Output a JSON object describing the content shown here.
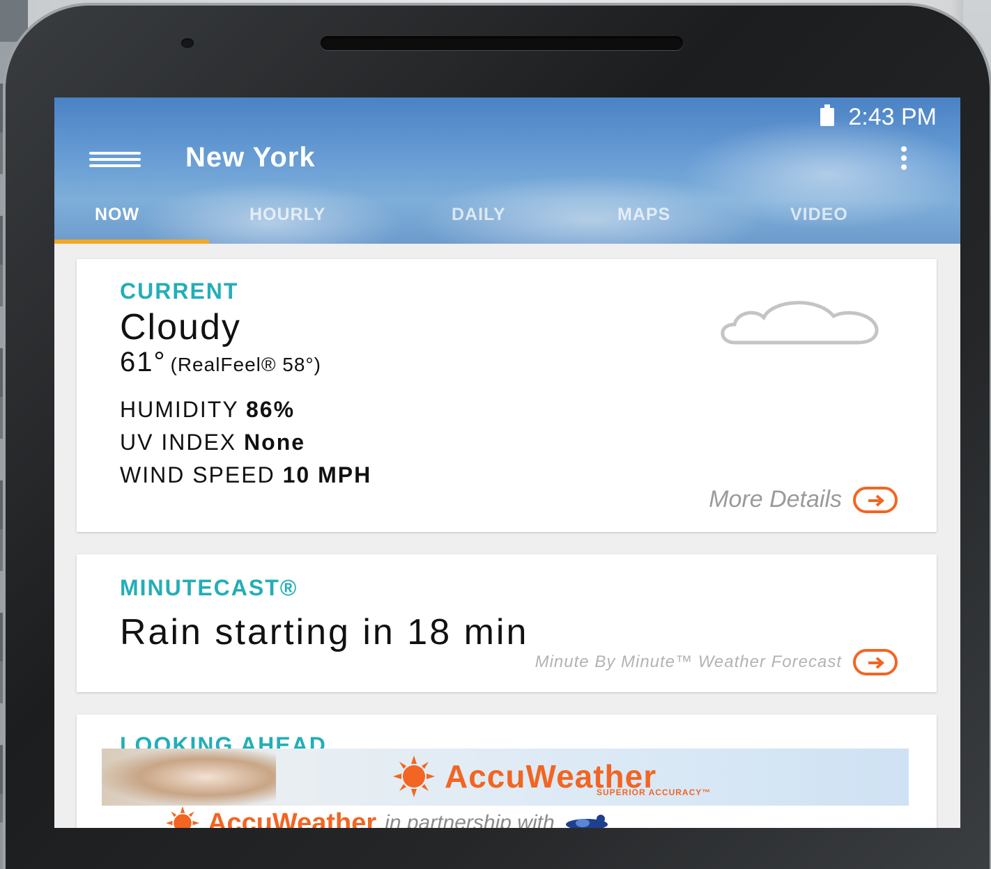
{
  "status_bar": {
    "time": "2:43 PM"
  },
  "header": {
    "city": "New York",
    "tabs": [
      {
        "label": "NOW",
        "active": true
      },
      {
        "label": "HOURLY",
        "active": false
      },
      {
        "label": "DAILY",
        "active": false
      },
      {
        "label": "MAPS",
        "active": false
      },
      {
        "label": "VIDEO",
        "active": false
      }
    ]
  },
  "current": {
    "label": "CURRENT",
    "condition": "Cloudy",
    "temperature": "61°",
    "realfeel": "(RealFeel® 58°)",
    "humidity_label": "HUMIDITY",
    "humidity_value": "86%",
    "uv_label": "UV INDEX",
    "uv_value": "None",
    "wind_label": "WIND SPEED",
    "wind_value": "10 MPH",
    "more_details": "More Details",
    "icon": "cloud-icon"
  },
  "minutecast": {
    "label": "MINUTECAST®",
    "text": "Rain starting in 18 min",
    "link": "Minute By Minute™ Weather Forecast"
  },
  "looking_ahead": {
    "label": "LOOKING AHEAD"
  },
  "ad": {
    "brand": "AccuWeather",
    "tagline": "SUPERIOR ACCURACY™",
    "partner_brand": "AccuWeather",
    "partner_text": "in partnership with"
  },
  "colors": {
    "accent_teal": "#23aeb8",
    "brand_orange": "#f26522",
    "tab_indicator": "#f5a623",
    "header_blue": "#5f94cf"
  }
}
